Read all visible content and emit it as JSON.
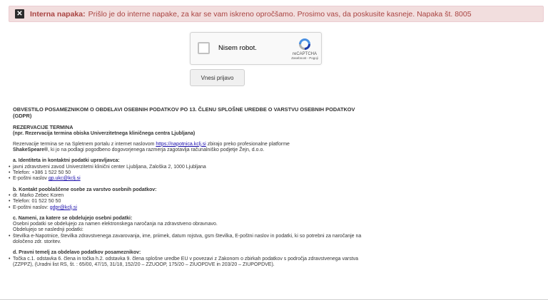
{
  "alert": {
    "title": "Interna napaka:",
    "message": "Prišlo je do interne napake, za kar se vam iskreno opročšamo. Prosimo vas, da poskusite kasneje. Napaka št. 8005"
  },
  "captcha": {
    "label": "Nisem robot.",
    "brand": "reCAPTCHA",
    "links": "Zasebnost - Pogoji"
  },
  "submit_label": "Vnesi prijavo",
  "notice": {
    "heading": "OBVESTILO POSAMEZNIKOM O OBDELAVI OSEBNIH PODATKOV PO 13. ČLENU SPLOŠNE UREDBE O VARSTVU OSEBNIH PODATKOV (GDPR)",
    "section_title": "REZERVACIJE TERMINA",
    "section_subtitle": "(npr. Rezervacija termina obiska Univerzitetnega kliničnega centra Ljubljana)",
    "intro_pre": "Rezervacije termina se na Spletnem portalu z internet naslovom ",
    "intro_link": "https://napotnica.kclj.si",
    "intro_mid": " zbirajo preko profesionalne platforme ",
    "intro_bold": "ShakeSpeare®",
    "intro_post": ", ki jo na podlagi pogodbeno dogovorjenega razmerja zagotavlja računalniško podjetje Žejn, d.o.o.",
    "a_title": "a. Identiteta in kontaktni podatki upravljavca:",
    "a_items": {
      "name": "javni zdravstveni zavod Univerzitetni klinični center Ljubljana, Zaloška 2, 1000 Ljubljana",
      "phone": "Telefon: +386 1 522 50 50",
      "email_pre": "E-poštni naslov ",
      "email_link": "gp.ukc@kclj.si"
    },
    "b_title": "b. Kontakt pooblaščene osebe za varstvo osebnih podatkov:",
    "b_items": {
      "name": "dr. Marko Zebec Koren",
      "phone": "Telefon: 01 522 50 50",
      "email_pre": "E-poštni naslov: ",
      "email_link": "gdpr@kclj.si"
    },
    "c_title": "c. Nameni, za katere se obdelujejo osebni podatki:",
    "c_text1": "Osebni podatki se obdelujejo za namen elektronskega naročanja na zdravstveno obravnavo.",
    "c_text2": "Obdelujejo se naslednji podatki:",
    "c_item": "številka e-Napotnice, številka zdravstvenega zavarovanja, ime, priimek, datum rojstva, gsm številka, E-poštni naslov in podatki, ki so potrebni za naročanje na določeno zdr. storitev.",
    "d_title": "d. Pravni temelj za obdelavo podatkov posameznikov:",
    "d_item": "Točka c.1. odstavka 6. člena in točka h.2. odstavka 9. člena splošne uredbe EU v povezavi z Zakonom o zbirkah podatkov s področja zdravstvenega varstva (ZZPPZ), (Uradni list RS, št. : 65/00, 47/15, 31/18, 152/20 – ZZUOOP, 175/20 – ZIUOPDVE in 203/20 – ZIUPOPDVE)."
  },
  "colors": {
    "alert_bg": "#f2dede",
    "alert_text": "#a94442",
    "link": "#1a0dab"
  }
}
